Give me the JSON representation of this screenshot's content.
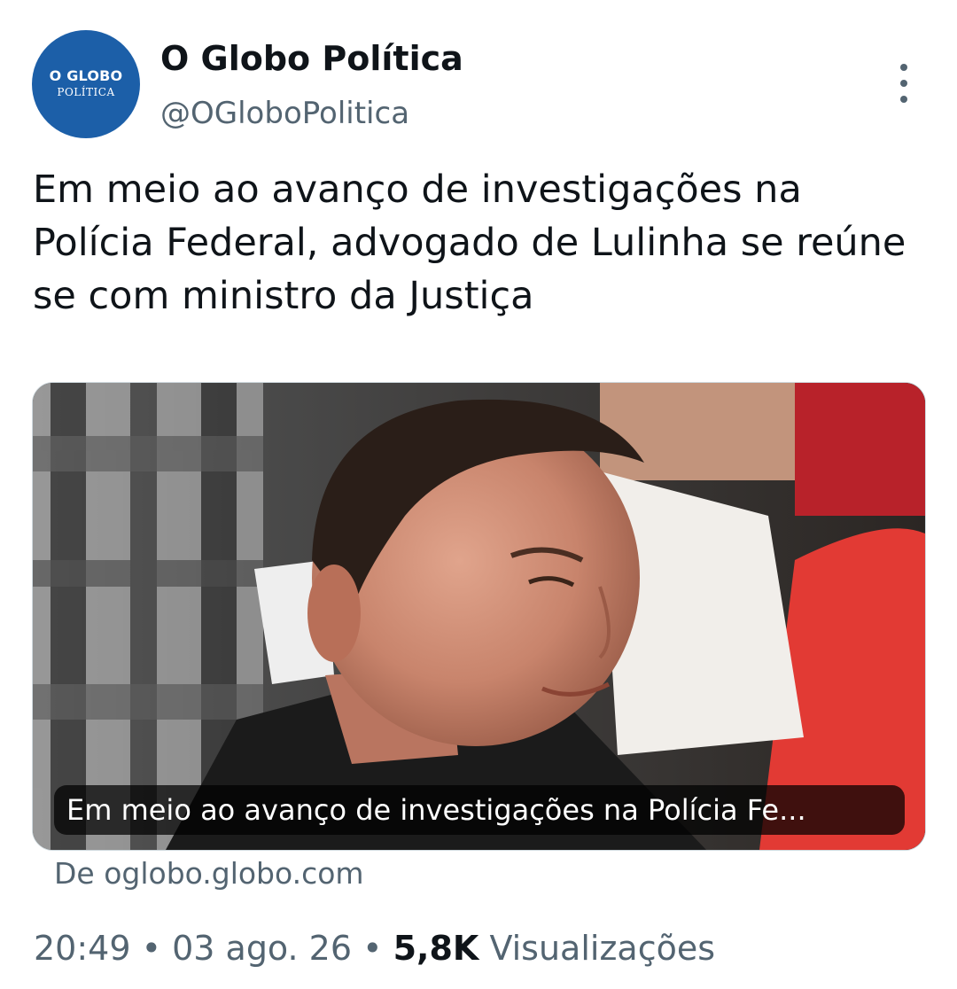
{
  "account": {
    "name": "O Globo Política",
    "handle": "@OGloboPolitica",
    "avatar_line1": "O GLOBO",
    "avatar_line2": "POLÍTICA"
  },
  "tweet": {
    "text": "Em meio ao avanço de investigações na Polícia Federal, advogado de Lulinha se reúne se com ministro da Justiça"
  },
  "card": {
    "caption": "Em meio ao avanço de investigações na Polícia Fe...",
    "image_icon": "news-photo"
  },
  "source": "De oglobo.globo.com",
  "meta": {
    "time": "20:49",
    "sep1": " • ",
    "date": "03 ago. 26",
    "sep2": " • ",
    "views_count": "5,8K",
    "views_label": " Visualizações"
  },
  "colors": {
    "avatar_bg": "#1c5fa8",
    "text_primary": "#0f1419",
    "text_secondary": "#536471"
  },
  "icons": {
    "more": "more-vertical-icon"
  }
}
